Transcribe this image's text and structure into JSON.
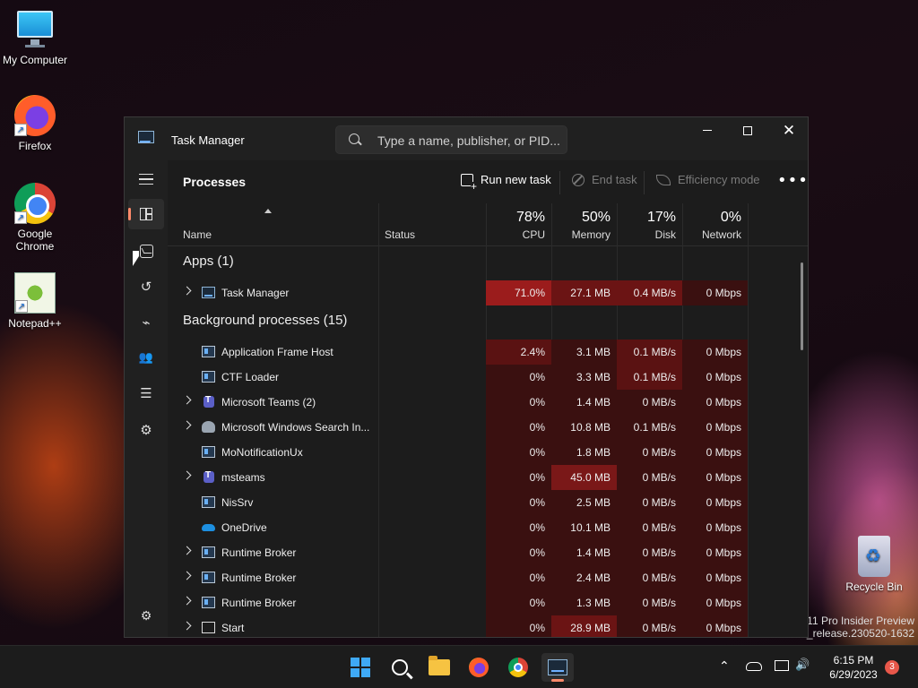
{
  "desktop": {
    "icons": [
      {
        "label": "My Computer"
      },
      {
        "label": "Firefox"
      },
      {
        "label": "Google Chrome"
      },
      {
        "label": "Notepad++"
      },
      {
        "label": "Recycle Bin"
      }
    ],
    "watermark_line1": "11 Pro Insider Preview",
    "watermark_line2": "n_release.230520-1632"
  },
  "window": {
    "title": "Task Manager",
    "search_placeholder": "Type a name, publisher, or PID...",
    "minimize_icon": "minimize-icon",
    "maximize_icon": "maximize-icon",
    "close_glyph": "✕"
  },
  "nav": {
    "items": [
      "menu-icon",
      "processes-icon",
      "performance-icon",
      "app-history-icon",
      "startup-apps-icon",
      "users-icon",
      "details-icon",
      "services-icon",
      "settings-icon"
    ],
    "glyphs": {
      "history": "↺",
      "startup": "⌁",
      "users": "👥",
      "details": "☰",
      "services": "⚙",
      "settings": "⚙"
    }
  },
  "main": {
    "page_title": "Processes",
    "run_new_task": "Run new task",
    "end_task": "End task",
    "efficiency_mode": "Efficiency mode",
    "more": "•••"
  },
  "table": {
    "headers": {
      "name": "Name",
      "status": "Status",
      "cpu": {
        "pct": "78%",
        "label": "CPU"
      },
      "memory": {
        "pct": "50%",
        "label": "Memory"
      },
      "disk": {
        "pct": "17%",
        "label": "Disk"
      },
      "network": {
        "pct": "0%",
        "label": "Network"
      }
    },
    "groups": {
      "apps": "Apps (1)",
      "background": "Background processes (15)"
    },
    "rows": [
      {
        "name": "Task Manager",
        "expand": true,
        "icon": "task-manager-icon",
        "cpu": "71.0%",
        "memory": "27.1 MB",
        "disk": "0.4 MB/s",
        "network": "0 Mbps",
        "cpuColor": "#9b1c1c",
        "memColor": "#6b1414",
        "diskColor": "#6b1414",
        "netColor": "#3a1010"
      },
      {
        "name": "Application Frame Host",
        "expand": false,
        "icon": "window-icon",
        "cpu": "2.4%",
        "memory": "3.1 MB",
        "disk": "0.1 MB/s",
        "network": "0 Mbps",
        "cpuColor": "#5a1212",
        "memColor": "#3a1010",
        "diskColor": "#5a1212",
        "netColor": "#3a1010"
      },
      {
        "name": "CTF Loader",
        "expand": false,
        "icon": "window-icon",
        "cpu": "0%",
        "memory": "3.3 MB",
        "disk": "0.1 MB/s",
        "network": "0 Mbps",
        "cpuColor": "#3a1010",
        "memColor": "#3a1010",
        "diskColor": "#5a1212",
        "netColor": "#3a1010"
      },
      {
        "name": "Microsoft Teams (2)",
        "expand": true,
        "icon": "teams-icon",
        "cpu": "0%",
        "memory": "1.4 MB",
        "disk": "0 MB/s",
        "network": "0 Mbps",
        "cpuColor": "#3a1010",
        "memColor": "#3a1010",
        "diskColor": "#3a1010",
        "netColor": "#3a1010"
      },
      {
        "name": "Microsoft Windows Search In...",
        "expand": true,
        "icon": "search-indexer-icon",
        "cpu": "0%",
        "memory": "10.8 MB",
        "disk": "0.1 MB/s",
        "network": "0 Mbps",
        "cpuColor": "#3a1010",
        "memColor": "#3a1010",
        "diskColor": "#3a1010",
        "netColor": "#3a1010"
      },
      {
        "name": "MoNotificationUx",
        "expand": false,
        "icon": "window-icon",
        "cpu": "0%",
        "memory": "1.8 MB",
        "disk": "0 MB/s",
        "network": "0 Mbps",
        "cpuColor": "#3a1010",
        "memColor": "#3a1010",
        "diskColor": "#3a1010",
        "netColor": "#3a1010"
      },
      {
        "name": "msteams",
        "expand": true,
        "icon": "teams-icon",
        "cpu": "0%",
        "memory": "45.0 MB",
        "disk": "0 MB/s",
        "network": "0 Mbps",
        "cpuColor": "#3a1010",
        "memColor": "#7a1818",
        "diskColor": "#3a1010",
        "netColor": "#3a1010"
      },
      {
        "name": "NisSrv",
        "expand": false,
        "icon": "window-icon",
        "cpu": "0%",
        "memory": "2.5 MB",
        "disk": "0 MB/s",
        "network": "0 Mbps",
        "cpuColor": "#3a1010",
        "memColor": "#3a1010",
        "diskColor": "#3a1010",
        "netColor": "#3a1010"
      },
      {
        "name": "OneDrive",
        "expand": false,
        "icon": "onedrive-icon",
        "cpu": "0%",
        "memory": "10.1 MB",
        "disk": "0 MB/s",
        "network": "0 Mbps",
        "cpuColor": "#3a1010",
        "memColor": "#3a1010",
        "diskColor": "#3a1010",
        "netColor": "#3a1010"
      },
      {
        "name": "Runtime Broker",
        "expand": true,
        "icon": "window-icon",
        "cpu": "0%",
        "memory": "1.4 MB",
        "disk": "0 MB/s",
        "network": "0 Mbps",
        "cpuColor": "#3a1010",
        "memColor": "#3a1010",
        "diskColor": "#3a1010",
        "netColor": "#3a1010"
      },
      {
        "name": "Runtime Broker",
        "expand": true,
        "icon": "window-icon",
        "cpu": "0%",
        "memory": "2.4 MB",
        "disk": "0 MB/s",
        "network": "0 Mbps",
        "cpuColor": "#3a1010",
        "memColor": "#3a1010",
        "diskColor": "#3a1010",
        "netColor": "#3a1010"
      },
      {
        "name": "Runtime Broker",
        "expand": true,
        "icon": "window-icon",
        "cpu": "0%",
        "memory": "1.3 MB",
        "disk": "0 MB/s",
        "network": "0 Mbps",
        "cpuColor": "#3a1010",
        "memColor": "#3a1010",
        "diskColor": "#3a1010",
        "netColor": "#3a1010"
      },
      {
        "name": "Start",
        "expand": true,
        "icon": "start-icon",
        "cpu": "0%",
        "memory": "28.9 MB",
        "disk": "0 MB/s",
        "network": "0 Mbps",
        "cpuColor": "#3a1010",
        "memColor": "#6b1414",
        "diskColor": "#3a1010",
        "netColor": "#3a1010"
      }
    ]
  },
  "taskbar": {
    "clock_time": "6:15 PM",
    "clock_date": "6/29/2023",
    "notification_count": "3",
    "tray_chevron": "⌃",
    "tray_volume": "🔊"
  }
}
